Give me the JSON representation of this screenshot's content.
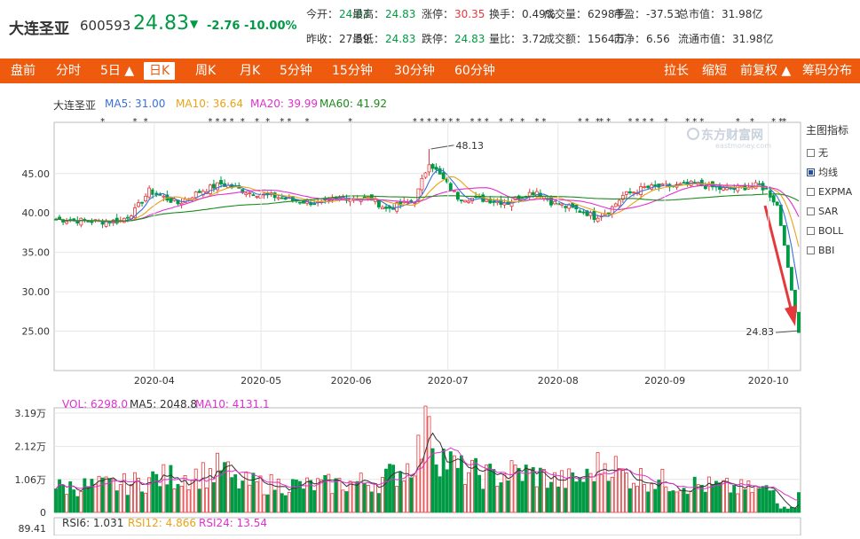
{
  "stock": {
    "name": "大连圣亚",
    "code": "600593",
    "price": "24.83",
    "arrow": "▼",
    "change": "-2.76",
    "change_pct": "-10.00%"
  },
  "quote": [
    [
      {
        "label": "今开：",
        "value": "24.83",
        "cls": "g"
      },
      {
        "label": "最高：",
        "value": "24.83",
        "cls": "g"
      },
      {
        "label": "涨停：",
        "value": "30.35",
        "cls": "r"
      },
      {
        "label": "换手：",
        "value": "0.49%",
        "cls": ""
      },
      {
        "label": "成交量：",
        "value": "6298手",
        "cls": ""
      },
      {
        "label": "市盈：",
        "value": "-37.53",
        "cls": ""
      },
      {
        "label": "总市值：",
        "value": "31.98亿",
        "cls": ""
      }
    ],
    [
      {
        "label": "昨收：",
        "value": "27.59",
        "cls": ""
      },
      {
        "label": "最低：",
        "value": "24.83",
        "cls": "g"
      },
      {
        "label": "跌停：",
        "value": "24.83",
        "cls": "g"
      },
      {
        "label": "量比：",
        "value": "3.72",
        "cls": ""
      },
      {
        "label": "成交额：",
        "value": "1564万",
        "cls": ""
      },
      {
        "label": "市净：",
        "value": "6.56",
        "cls": ""
      },
      {
        "label": "流通市值：",
        "value": "31.98亿",
        "cls": ""
      }
    ]
  ],
  "toolbar": {
    "left": [
      "盘前",
      "分时",
      "5日 ▲",
      "日K",
      "周K",
      "月K",
      "5分钟",
      "15分钟",
      "30分钟",
      "60分钟"
    ],
    "active_index": 3,
    "right": [
      "拉长",
      "缩短",
      "前复权 ▲",
      "筹码分布"
    ]
  },
  "ma_legend": [
    {
      "text": "大连圣亚",
      "color": "#333333"
    },
    {
      "text": "MA5: 31.00",
      "color": "#3a6fd8"
    },
    {
      "text": "MA10: 36.64",
      "color": "#e8a317"
    },
    {
      "text": "MA20: 39.99",
      "color": "#e030d0"
    },
    {
      "text": "MA60: 41.92",
      "color": "#1e8a1e"
    }
  ],
  "vol_legend": [
    {
      "text": "VOL: 6298.0",
      "color": "#e030d0"
    },
    {
      "text": "MA5: 2048.8",
      "color": "#333333"
    },
    {
      "text": "MA10: 4131.1",
      "color": "#e030d0"
    }
  ],
  "rsi_legend": [
    {
      "text": "RSI6: 1.031",
      "color": "#333333"
    },
    {
      "text": "RSI12: 4.866",
      "color": "#e8a317"
    },
    {
      "text": "RSI24: 13.54",
      "color": "#e030d0"
    }
  ],
  "side_panel": {
    "title": "主图指标",
    "options": [
      {
        "label": "无",
        "on": false
      },
      {
        "label": "均线",
        "on": true
      },
      {
        "label": "EXPMA",
        "on": false
      },
      {
        "label": "SAR",
        "on": false
      },
      {
        "label": "BOLL",
        "on": false
      },
      {
        "label": "BBI",
        "on": false
      }
    ]
  },
  "watermark": {
    "cn": "东方财富网",
    "en": "eastmoney.com"
  },
  "colors": {
    "up": "#e4393c",
    "down": "#009a44",
    "accent": "#ee5b0e",
    "arrow": "#e4393c",
    "grid": "#e6e6e6"
  },
  "chart_data": {
    "type": "candlestick",
    "price_axis": {
      "ticks": [
        25,
        30,
        35,
        40,
        45
      ],
      "tick_labels": [
        "25.00",
        "30.00",
        "35.00",
        "40.00",
        "45.00"
      ],
      "ylim": [
        20,
        51.5
      ]
    },
    "x_tick_labels": [
      "2020-04",
      "2020-05",
      "2020-06",
      "2020-07",
      "2020-08",
      "2020-09",
      "2020-10"
    ],
    "high_annotation": "48.13",
    "last_annotation": "24.83",
    "volume_axis": {
      "tick_labels": [
        "3.19万",
        "2.12万",
        "1.06万",
        "0"
      ],
      "ticks": [
        31900,
        21200,
        10600,
        0
      ]
    },
    "rsi_axis": {
      "top_label": "89.41"
    },
    "segments": [
      [
        0,
        39.2
      ],
      [
        12,
        38.9
      ],
      [
        18,
        39.0
      ],
      [
        22,
        40.3
      ],
      [
        26,
        42.8
      ],
      [
        34,
        41.2
      ],
      [
        40,
        42.7
      ],
      [
        46,
        43.7
      ],
      [
        54,
        42.6
      ],
      [
        60,
        42.2
      ],
      [
        66,
        41.6
      ],
      [
        74,
        41.2
      ],
      [
        80,
        42.0
      ],
      [
        88,
        41.8
      ],
      [
        92,
        40.5
      ],
      [
        100,
        41.6
      ],
      [
        104,
        46.5
      ],
      [
        108,
        44.2
      ],
      [
        112,
        42.0
      ],
      [
        120,
        41.7
      ],
      [
        126,
        41.3
      ],
      [
        130,
        42.2
      ],
      [
        134,
        42.8
      ],
      [
        138,
        41.4
      ],
      [
        142,
        40.8
      ],
      [
        148,
        40.0
      ],
      [
        150,
        39.5
      ],
      [
        154,
        40.2
      ],
      [
        158,
        42.2
      ],
      [
        164,
        43.2
      ],
      [
        172,
        43.4
      ],
      [
        178,
        43.7
      ],
      [
        186,
        43.0
      ],
      [
        192,
        43.3
      ],
      [
        196,
        43.5
      ],
      [
        198,
        42.9
      ],
      [
        201,
        41.0
      ],
      [
        202,
        38.4
      ],
      [
        203,
        35.9
      ],
      [
        204,
        33.1
      ],
      [
        205,
        30.2
      ],
      [
        206,
        27.4
      ],
      [
        207,
        24.83
      ]
    ],
    "volume_segments": [
      [
        0,
        8000
      ],
      [
        20,
        9000
      ],
      [
        28,
        11000
      ],
      [
        44,
        12500
      ],
      [
        46,
        15000
      ],
      [
        50,
        9500
      ],
      [
        70,
        8500
      ],
      [
        90,
        10000
      ],
      [
        98,
        14500
      ],
      [
        102,
        21500
      ],
      [
        104,
        29000
      ],
      [
        106,
        20000
      ],
      [
        112,
        13500
      ],
      [
        122,
        11500
      ],
      [
        128,
        13000
      ],
      [
        134,
        12000
      ],
      [
        140,
        10000
      ],
      [
        148,
        11000
      ],
      [
        150,
        14000
      ],
      [
        154,
        16500
      ],
      [
        158,
        12000
      ],
      [
        166,
        10500
      ],
      [
        176,
        9000
      ],
      [
        192,
        7500
      ],
      [
        200,
        7000
      ],
      [
        202,
        1500
      ],
      [
        206,
        1200
      ],
      [
        207,
        6300
      ]
    ],
    "ma_last": {
      "MA5": 31.0,
      "MA10": 36.64,
      "MA20": 39.99,
      "MA60": 41.92
    }
  }
}
